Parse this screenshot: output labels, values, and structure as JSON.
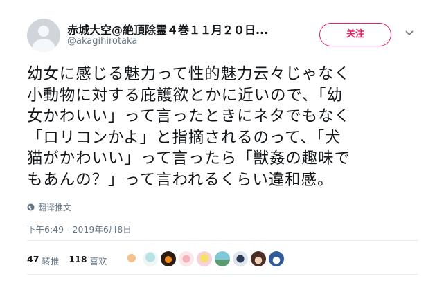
{
  "author": {
    "display_name": "赤城大空@絶頂除霊４巻１１月２０日...",
    "handle": "@akagihirotaka"
  },
  "follow_button": {
    "label": "关注"
  },
  "tweet": {
    "lines": [
      "幼女に感じる魅力って性的魅力云々じゃなく",
      "小動物に対する庇護欲とかに近いので、「幼",
      "女かわいい」って言ったときにネタでもなく",
      "「ロリコンかよ」と指摘されるのって、「犬",
      "猫がかわいい」って言ったら「獣姦の趣味で",
      "もあんの？」って言われるくらい違和感。"
    ]
  },
  "translate": {
    "label": "翻译推文"
  },
  "timestamp": "下午6:49 - 2019年6月8日",
  "stats": {
    "retweets_count": "47",
    "retweets_label": "转推",
    "likes_count": "118",
    "likes_label": "喜欢"
  },
  "colors": {
    "follow_accent": "#e0245e",
    "muted_text": "#657786",
    "divider": "#e6ecf0"
  }
}
